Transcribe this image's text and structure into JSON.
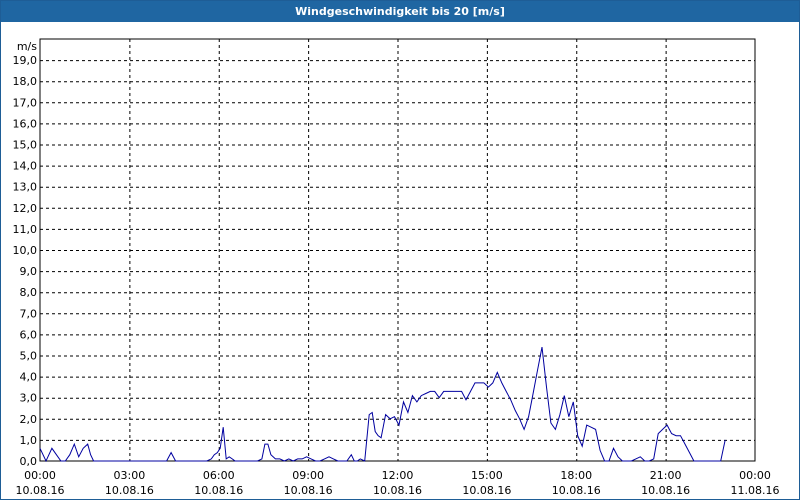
{
  "title": "Windgeschwindigkeit bis 20 [m/s]",
  "chart_data": {
    "type": "line",
    "ylabel": "m/s",
    "ylim": [
      0,
      20
    ],
    "y_ticks": [
      "0,0",
      "1,0",
      "2,0",
      "3,0",
      "4,0",
      "5,0",
      "6,0",
      "7,0",
      "8,0",
      "9,0",
      "10,0",
      "11,0",
      "12,0",
      "13,0",
      "14,0",
      "15,0",
      "16,0",
      "17,0",
      "18,0",
      "19,0"
    ],
    "x_ticks": [
      {
        "time": "00:00",
        "date": "10.08.16"
      },
      {
        "time": "03:00",
        "date": "10.08.16"
      },
      {
        "time": "06:00",
        "date": "10.08.16"
      },
      {
        "time": "09:00",
        "date": "10.08.16"
      },
      {
        "time": "12:00",
        "date": "10.08.16"
      },
      {
        "time": "15:00",
        "date": "10.08.16"
      },
      {
        "time": "18:00",
        "date": "10.08.16"
      },
      {
        "time": "21:00",
        "date": "10.08.16"
      },
      {
        "time": "00:00",
        "date": "11.08.16"
      }
    ],
    "grid": true,
    "colors": {
      "line": "#0000a0",
      "grid": "#000000",
      "title_bar": "#1f66a2"
    },
    "series": [
      {
        "x_hours": [
          0,
          0.2,
          0.4,
          0.55,
          0.7,
          0.85,
          1.0,
          1.15,
          1.3,
          1.45,
          1.6,
          1.7,
          1.8,
          1.95,
          2.1,
          2.25,
          2.4,
          2.5,
          2.6,
          2.75,
          2.9,
          3.0,
          3.1,
          3.2,
          3.3,
          3.4,
          3.5,
          3.6,
          3.7,
          3.8,
          3.95,
          4.1,
          4.25,
          4.4,
          4.55,
          4.7,
          4.85,
          5.0,
          5.15,
          5.3,
          5.45,
          5.6,
          5.75,
          5.85,
          5.95,
          6.05,
          6.15,
          6.25,
          6.35,
          6.45,
          6.55,
          6.7,
          6.85,
          7.0,
          7.15,
          7.3,
          7.45,
          7.55,
          7.65,
          7.75,
          7.9,
          8.05,
          8.2,
          8.35,
          8.5,
          8.65,
          8.8,
          8.95,
          9.1,
          9.25,
          9.4,
          9.55,
          9.7,
          9.85,
          10.0,
          10.15,
          10.3,
          10.45,
          10.55,
          10.65,
          10.75,
          10.9,
          11.05,
          11.15,
          11.25,
          11.35,
          11.45,
          11.6,
          11.75,
          11.9,
          12.05,
          12.2,
          12.35,
          12.5,
          12.65,
          12.8,
          12.95,
          13.1,
          13.25,
          13.4,
          13.55,
          13.7,
          13.85,
          14.0,
          14.15,
          14.3,
          14.45,
          14.6,
          14.75,
          14.9,
          15.05,
          15.2,
          15.35,
          15.5,
          15.65,
          15.8,
          15.95,
          16.1,
          16.25,
          16.4,
          16.55,
          16.7,
          16.85,
          17.0,
          17.15,
          17.3,
          17.45,
          17.6,
          17.75,
          17.9,
          18.05,
          18.2,
          18.35,
          18.5,
          18.65,
          18.8,
          18.95,
          19.1,
          19.25,
          19.4,
          19.55,
          19.7,
          19.85,
          20.0,
          20.15,
          20.3,
          20.45,
          20.6,
          20.75,
          20.9,
          21.05,
          21.2,
          21.35,
          21.5,
          21.65,
          21.8,
          21.95,
          22.1,
          22.25,
          22.4,
          22.55,
          22.7,
          22.85,
          23.0,
          23.15,
          23.3,
          23.45,
          23.6,
          23.8,
          24.0
        ],
        "values": [
          0.6,
          0.0,
          0.6,
          0.3,
          0.0,
          0.0,
          0.3,
          0.8,
          0.2,
          0.6,
          0.8,
          0.3,
          0.0,
          0.0,
          0.0,
          0.0,
          0.0,
          0.0,
          0.0,
          0.0,
          0.0,
          0.0,
          0.0,
          0.0,
          0.0,
          0.0,
          0.0,
          0.0,
          0.0,
          0.0,
          0.0,
          0.0,
          0.0,
          0.4,
          0.0,
          0.0,
          0.0,
          0.0,
          0.0,
          0.0,
          0.0,
          0.0,
          0.1,
          0.3,
          0.4,
          0.6,
          1.6,
          0.1,
          0.2,
          0.1,
          0.0,
          0.0,
          0.0,
          0.0,
          0.0,
          0.0,
          0.1,
          0.8,
          0.8,
          0.3,
          0.1,
          0.1,
          0.0,
          0.1,
          0.0,
          0.1,
          0.1,
          0.2,
          0.1,
          0.0,
          0.0,
          0.1,
          0.2,
          0.1,
          0.0,
          0.0,
          0.0,
          0.3,
          0.0,
          0.0,
          0.1,
          0.0,
          2.2,
          2.3,
          1.4,
          1.2,
          1.1,
          2.2,
          2.0,
          2.1,
          1.7,
          2.8,
          2.3,
          3.1,
          2.8,
          3.1,
          3.2,
          3.3,
          3.3,
          3.0,
          3.3,
          3.3,
          3.3,
          3.3,
          3.3,
          2.9,
          3.3,
          3.7,
          3.7,
          3.7,
          3.5,
          3.7,
          4.2,
          3.7,
          3.3,
          2.9,
          2.4,
          2.0,
          1.5,
          2.1,
          3.2,
          4.3,
          5.4,
          3.5,
          1.8,
          1.5,
          2.2,
          3.1,
          2.1,
          2.8,
          1.2,
          0.7,
          1.7,
          1.6,
          1.5,
          0.5,
          0.0,
          0.0,
          0.6,
          0.2,
          0.0,
          0.0,
          0.0,
          0.1,
          0.2,
          0.0,
          0.0,
          0.1,
          1.3,
          1.5,
          1.7,
          1.3,
          1.2,
          1.2,
          0.8,
          0.4,
          0.0,
          0.0,
          0.0,
          0.0,
          0.0,
          0.0,
          0.0,
          1.0
        ]
      }
    ]
  }
}
